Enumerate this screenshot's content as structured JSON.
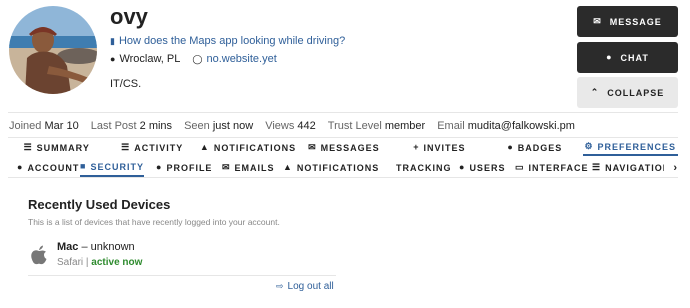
{
  "profile": {
    "username": "ovy",
    "bio_title": "How does the Maps app looking while driving?",
    "location": "Wroclaw, PL",
    "website": "no.website.yet",
    "role": "IT/CS."
  },
  "actions": {
    "message": "MESSAGE",
    "chat": "CHAT",
    "collapse": "COLLAPSE"
  },
  "stats": [
    {
      "label": "Joined",
      "value": "Mar 10"
    },
    {
      "label": "Last Post",
      "value": "2 mins"
    },
    {
      "label": "Seen",
      "value": "just now"
    },
    {
      "label": "Views",
      "value": "442"
    },
    {
      "label": "Trust Level",
      "value": "member"
    },
    {
      "label": "Email",
      "value": "mudita@falkowski.pm"
    }
  ],
  "primary_nav": [
    {
      "label": "SUMMARY",
      "icon": "list-icon"
    },
    {
      "label": "ACTIVITY",
      "icon": "stream-icon"
    },
    {
      "label": "NOTIFICATIONS",
      "icon": "bell-icon"
    },
    {
      "label": "MESSAGES",
      "icon": "envelope-icon"
    },
    {
      "label": "INVITES",
      "icon": "user-plus-icon"
    },
    {
      "label": "BADGES",
      "icon": "certificate-icon"
    },
    {
      "label": "PREFERENCES",
      "icon": "cog-icon"
    }
  ],
  "secondary_nav": [
    {
      "label": "ACCOUNT",
      "icon": "user-icon"
    },
    {
      "label": "SECURITY",
      "icon": "lock-icon"
    },
    {
      "label": "PROFILE",
      "icon": "user-icon"
    },
    {
      "label": "EMAILS",
      "icon": "envelope-icon"
    },
    {
      "label": "NOTIFICATIONS",
      "icon": "bell-icon"
    },
    {
      "label": "TRACKING",
      "icon": ""
    },
    {
      "label": "USERS",
      "icon": "users-icon"
    },
    {
      "label": "INTERFACE",
      "icon": "desktop-icon"
    },
    {
      "label": "NAVIGATION R",
      "icon": "bars-icon"
    }
  ],
  "devices": {
    "title": "Recently Used Devices",
    "description": "This is a list of devices that have recently logged into your account.",
    "items": [
      {
        "os": "Mac",
        "separator": " – ",
        "location": "unknown",
        "browser": "Safari",
        "divider": " | ",
        "status": "active now"
      }
    ],
    "logout_all": "Log out all"
  },
  "colors": {
    "link": "#2f5f99",
    "dark_button": "#2b2b2b",
    "light_button": "#e9e9e9",
    "active_status": "#2e8b2e"
  }
}
